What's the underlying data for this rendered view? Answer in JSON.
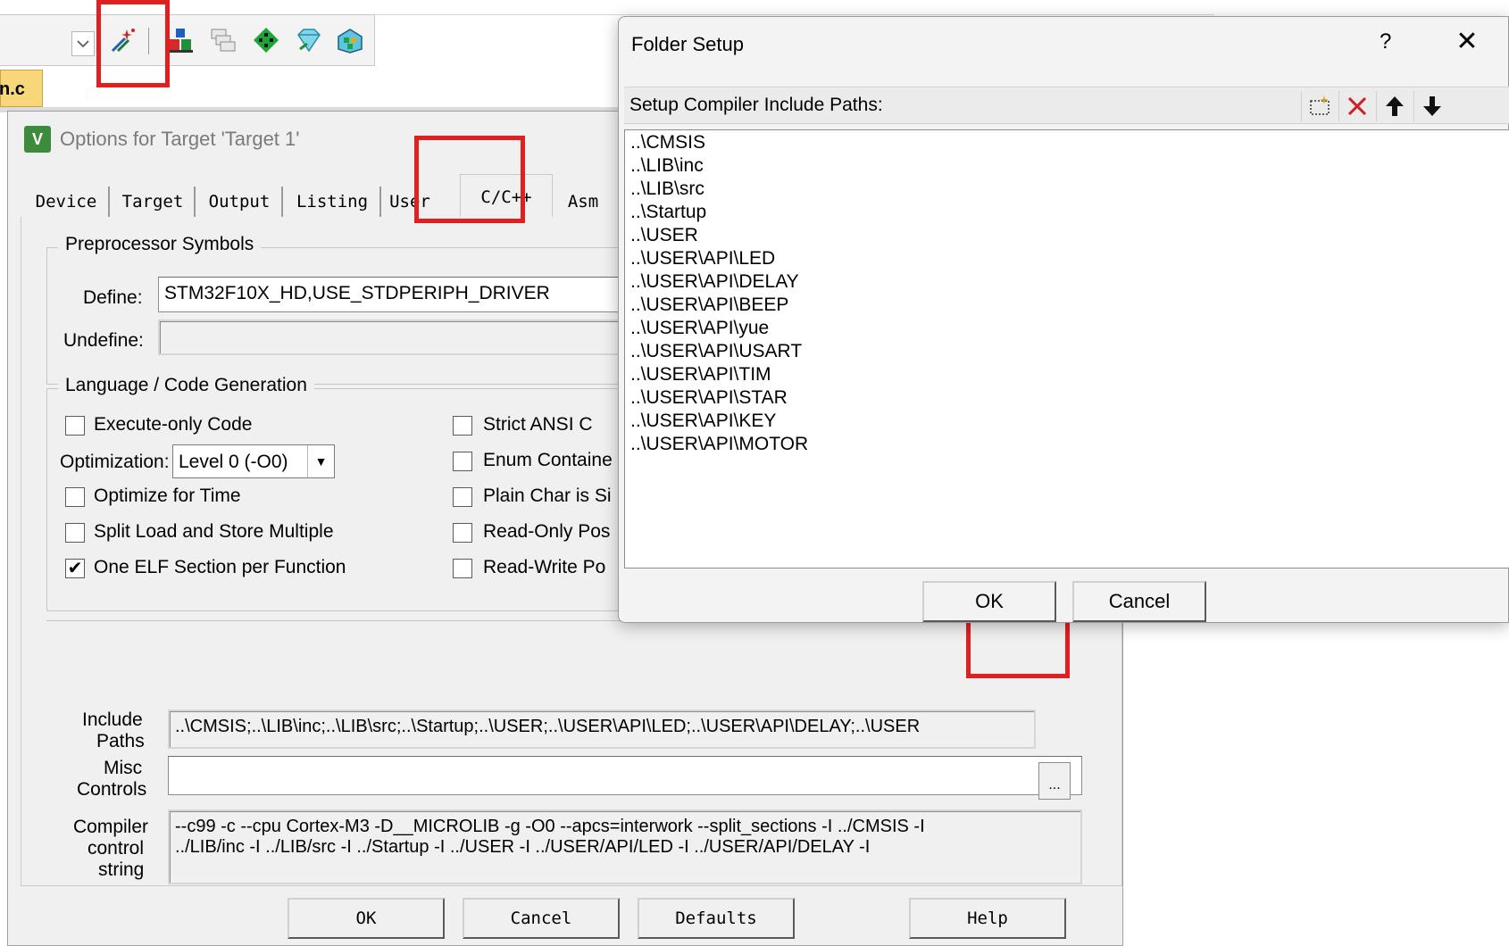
{
  "ide": {
    "file_tab": "n.c"
  },
  "options_dialog": {
    "title": "Options for Target 'Target 1'",
    "tabs": [
      {
        "label": "Device"
      },
      {
        "label": "Target"
      },
      {
        "label": "Output"
      },
      {
        "label": "Listing"
      },
      {
        "label": "User"
      },
      {
        "label": "C/C++"
      },
      {
        "label": "Asm"
      }
    ],
    "preprocessor": {
      "legend": "Preprocessor Symbols",
      "define_label": "Define:",
      "define_value": "STM32F10X_HD,USE_STDPERIPH_DRIVER",
      "undefine_label": "Undefine:",
      "undefine_value": ""
    },
    "language": {
      "legend": "Language / Code Generation",
      "execute_only": {
        "label": "Execute-only Code",
        "checked": false
      },
      "optimization_label": "Optimization:",
      "optimization_value": "Level 0 (-O0)",
      "optimize_time": {
        "label": "Optimize for Time",
        "checked": false
      },
      "split_load": {
        "label": "Split Load and Store Multiple",
        "checked": false
      },
      "one_elf": {
        "label": "One ELF Section per Function",
        "checked": true,
        "mark": "✔"
      },
      "strict_ansi": {
        "label": "Strict ANSI C",
        "checked": false
      },
      "enum_container": {
        "label": "Enum Containe",
        "checked": false
      },
      "plain_char": {
        "label": "Plain Char is Si",
        "checked": false
      },
      "read_only": {
        "label": "Read-Only Pos",
        "checked": false
      },
      "read_write": {
        "label": "Read-Write Po",
        "checked": false
      }
    },
    "include_paths": {
      "label_line1": "Include",
      "label_line2": "Paths",
      "value": "..\\CMSIS;..\\LIB\\inc;..\\LIB\\src;..\\Startup;..\\USER;..\\USER\\API\\LED;..\\USER\\API\\DELAY;..\\USER",
      "browse_label": "..."
    },
    "misc": {
      "label_line1": "Misc",
      "label_line2": "Controls",
      "value": ""
    },
    "compiler": {
      "label_line1": "Compiler",
      "label_line2": "control",
      "label_line3": "string",
      "line1": "--c99 -c --cpu Cortex-M3 -D__MICROLIB -g -O0 --apcs=interwork --split_sections -I ../CMSIS -I",
      "line2": "../LIB/inc -I ../LIB/src -I ../Startup -I ../USER -I ../USER/API/LED -I ../USER/API/DELAY -I"
    },
    "buttons": {
      "ok": "OK",
      "cancel": "Cancel",
      "defaults": "Defaults",
      "help": "Help"
    }
  },
  "folder_setup": {
    "title": "Folder Setup",
    "help_glyph": "?",
    "close_glyph": "✕",
    "header": "Setup Compiler Include Paths:",
    "paths": [
      "..\\CMSIS",
      "..\\LIB\\inc",
      "..\\LIB\\src",
      "..\\Startup",
      "..\\USER",
      "..\\USER\\API\\LED",
      "..\\USER\\API\\DELAY",
      "..\\USER\\API\\BEEP",
      "..\\USER\\API\\yue",
      "..\\USER\\API\\USART",
      "..\\USER\\API\\TIM",
      "..\\USER\\API\\STAR",
      "..\\USER\\API\\KEY",
      "..\\USER\\API\\MOTOR"
    ],
    "ok": "OK",
    "cancel": "Cancel"
  },
  "colors": {
    "highlight_red": "#e02020",
    "dialog_bg": "#f0f0f0",
    "keil_green": "#3d8b3d"
  }
}
